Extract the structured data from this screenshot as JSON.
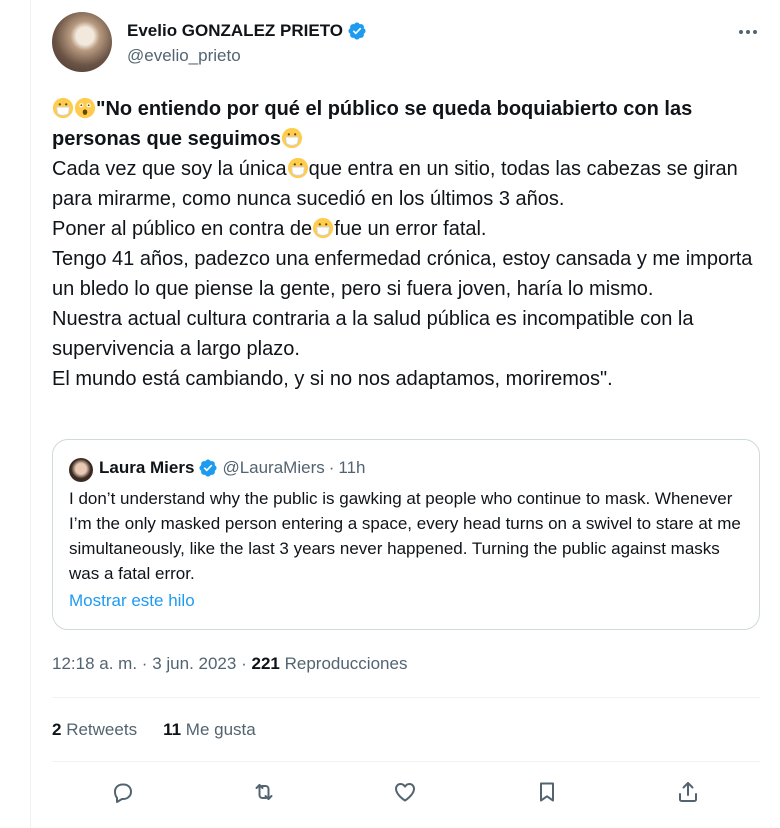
{
  "author": {
    "name": "Evelio GONZALEZ PRIETO",
    "handle": "@evelio_prieto"
  },
  "tweet": {
    "line1_bold": "\"No entiendo por qué el público se queda boquiabierto con las personas que seguimos",
    "line2a": "Cada vez que soy la única",
    "line2b": "que entra en un sitio, todas las cabezas se giran para mirarme, como nunca sucedió en los últimos 3 años.",
    "line3a": "Poner al público en contra de",
    "line3b": "fue un error fatal.",
    "line4": "Tengo 41 años, padezco una enfermedad crónica, estoy cansada y me importa un bledo lo que piense la gente, pero si fuera joven, haría lo mismo.",
    "line5": "Nuestra actual cultura contraria a la salud pública es incompatible con la supervivencia a largo plazo.",
    "line6": "El mundo está cambiando, y si no nos adaptamos, moriremos\"."
  },
  "quote": {
    "name": "Laura Miers",
    "handle": "@LauraMiers",
    "separator": "·",
    "time": "11h",
    "text": "I don’t understand why the public is gawking at people who continue to mask. Whenever I’m the only masked person entering a space, every head turns on a swivel to stare at me simultaneously, like the last 3 years never happened. Turning the public against masks was a fatal error.",
    "link": "Mostrar este hilo"
  },
  "meta": {
    "time": "12:18 a. m.",
    "sep1": "·",
    "date": "3 jun. 2023",
    "sep2": "·",
    "views_count": "221",
    "views_label": "Reproducciones"
  },
  "stats": {
    "retweets_count": "2",
    "retweets_label": "Retweets",
    "likes_count": "11",
    "likes_label": "Me gusta"
  },
  "icons": {
    "verified": "verified-badge-icon",
    "more": "more-options-icon",
    "mask": "face-with-medical-mask-emoji",
    "astonished": "astonished-face-emoji",
    "reply": "reply-icon",
    "retweet": "retweet-icon",
    "like": "heart-icon",
    "bookmark": "bookmark-icon",
    "share": "share-icon"
  },
  "colors": {
    "text": "#0f1419",
    "secondary": "#536471",
    "accent": "#1d9bf0",
    "border": "#cfd9de"
  }
}
